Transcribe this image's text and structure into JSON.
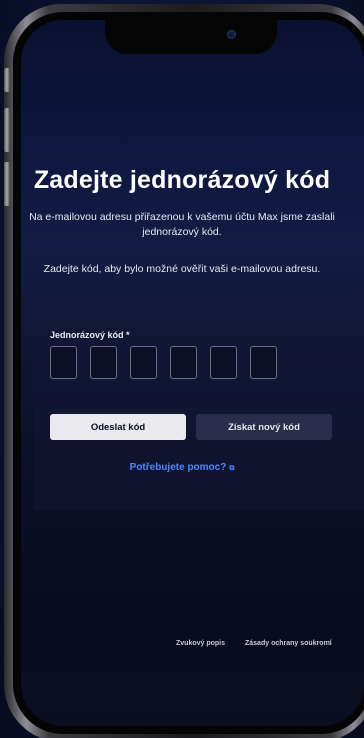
{
  "verification": {
    "title": "Zadejte jednorázový kód",
    "subtitle_line1": "Na e-mailovou adresu přiřazenou k vašemu účtu Max jsme zaslali",
    "subtitle_line2": "jednorázový kód.",
    "instruction": "Zadejte kód, aby bylo možné ověřit vaši e-mailovou adresu.",
    "code_label": "Jednorázový kód *",
    "code_digits": [
      "",
      "",
      "",
      "",
      "",
      ""
    ]
  },
  "actions": {
    "submit_label": "Odeslat kód",
    "resend_label": "Získat nový kód",
    "help_label": "Potřebujete pomoc?",
    "help_icon": "external-link-icon"
  },
  "footer": {
    "audio_description": "Zvukový popis",
    "privacy_policy": "Zásady ochrany soukromí"
  },
  "colors": {
    "link": "#4f87ff",
    "primary_button": "#e9e9ee",
    "secondary_button": "#2a2e4a"
  }
}
